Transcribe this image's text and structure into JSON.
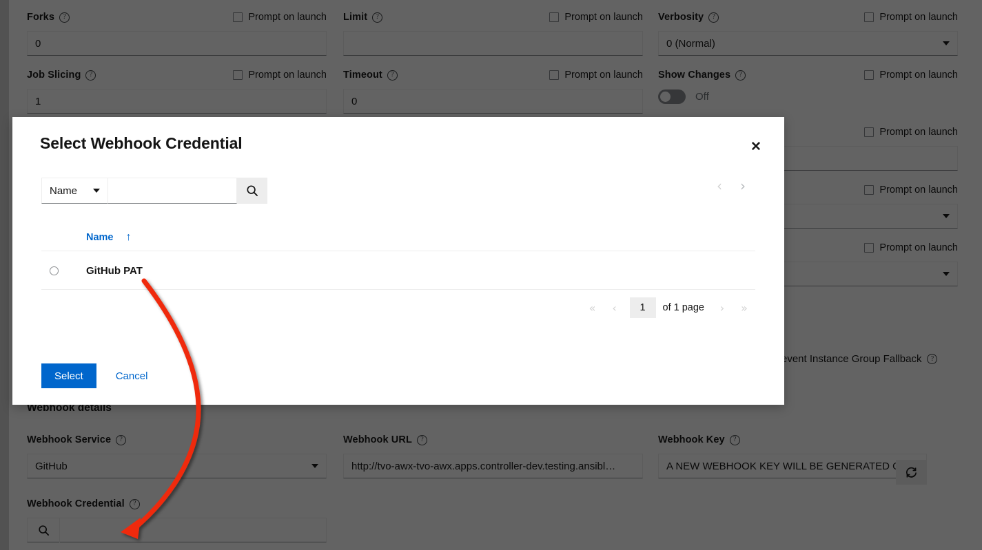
{
  "background_form": {
    "column_left": [
      {
        "label": "Forks",
        "help": "help-icon",
        "prompt_on_launch": "Prompt on launch",
        "value": "0",
        "type": "text"
      },
      {
        "label": "Job Slicing",
        "help": "help-icon",
        "prompt_on_launch": "Prompt on launch",
        "value": "1",
        "type": "text"
      }
    ],
    "column_middle": [
      {
        "label": "Limit",
        "help": "help-icon",
        "prompt_on_launch": "Prompt on launch",
        "value": "",
        "type": "text"
      },
      {
        "label": "Timeout",
        "help": "help-icon",
        "prompt_on_launch": "Prompt on launch",
        "value": "0",
        "type": "text"
      }
    ],
    "column_right": [
      {
        "label": "Verbosity",
        "help": "help-icon",
        "prompt_on_launch": "Prompt on launch",
        "value": "0 (Normal)",
        "type": "select"
      },
      {
        "label": "Show Changes",
        "help": "help-icon",
        "prompt_on_launch": "Prompt on launch",
        "value": "Off",
        "type": "toggle"
      }
    ],
    "hidden_right_fields": [
      {
        "prompt_on_launch": "Prompt on launch",
        "value": "",
        "type": "text"
      },
      {
        "prompt_on_launch": "Prompt on launch",
        "value": "",
        "type": "select"
      },
      {
        "prompt_on_launch": "Prompt on launch",
        "value": "",
        "type": "select"
      }
    ],
    "prevent_fallback_label": "revent Instance Group Fallback",
    "webhook_section": {
      "title": "Webhook details",
      "service": {
        "label": "Webhook Service",
        "help": "help-icon",
        "value": "GitHub",
        "type": "select"
      },
      "url": {
        "label": "Webhook URL",
        "help": "help-icon",
        "value": "http://tvo-awx-tvo-awx.apps.controller-dev.testing.ansibl…",
        "type": "text"
      },
      "key": {
        "label": "Webhook Key",
        "help": "help-icon",
        "value": "A NEW WEBHOOK KEY WILL BE GENERATED O…",
        "refresh_icon": "refresh-icon",
        "type": "text"
      },
      "credential": {
        "label": "Webhook Credential",
        "help": "help-icon",
        "search_icon": "search-icon",
        "value": "",
        "type": "lookup"
      }
    }
  },
  "modal": {
    "title": "Select Webhook Credential",
    "close_icon": "close-icon",
    "toolbar": {
      "filter_selected": "Name",
      "filter_caret_icon": "chevron-down-icon",
      "search_value": "",
      "search_icon": "search-icon",
      "prev_icon": "chevron-left-icon",
      "next_icon": "chevron-right-icon"
    },
    "table": {
      "columns": [
        "Name"
      ],
      "sort_icon": "sort-ascending-arrow-icon",
      "rows": [
        {
          "name": "GitHub PAT",
          "selected": false
        }
      ]
    },
    "pagination": {
      "first_icon": "angle-double-left-icon",
      "prev_icon": "angle-left-icon",
      "page_value": "1",
      "page_text": "of 1 page",
      "next_icon": "angle-right-icon",
      "last_icon": "angle-double-right-icon"
    },
    "footer": {
      "select_label": "Select",
      "cancel_label": "Cancel"
    }
  },
  "annotation": {
    "type": "curved-arrow",
    "color": "#ef2b0d",
    "from": "GitHub PAT row",
    "to": "Webhook Credential lookup field"
  },
  "colors": {
    "accent_blue": "#0066cc",
    "annotation_red": "#ef2b0d",
    "dim_overlay": "rgba(3,3,3,0.62)",
    "modal_bg": "#ffffff",
    "page_bg": "#ffffff"
  }
}
